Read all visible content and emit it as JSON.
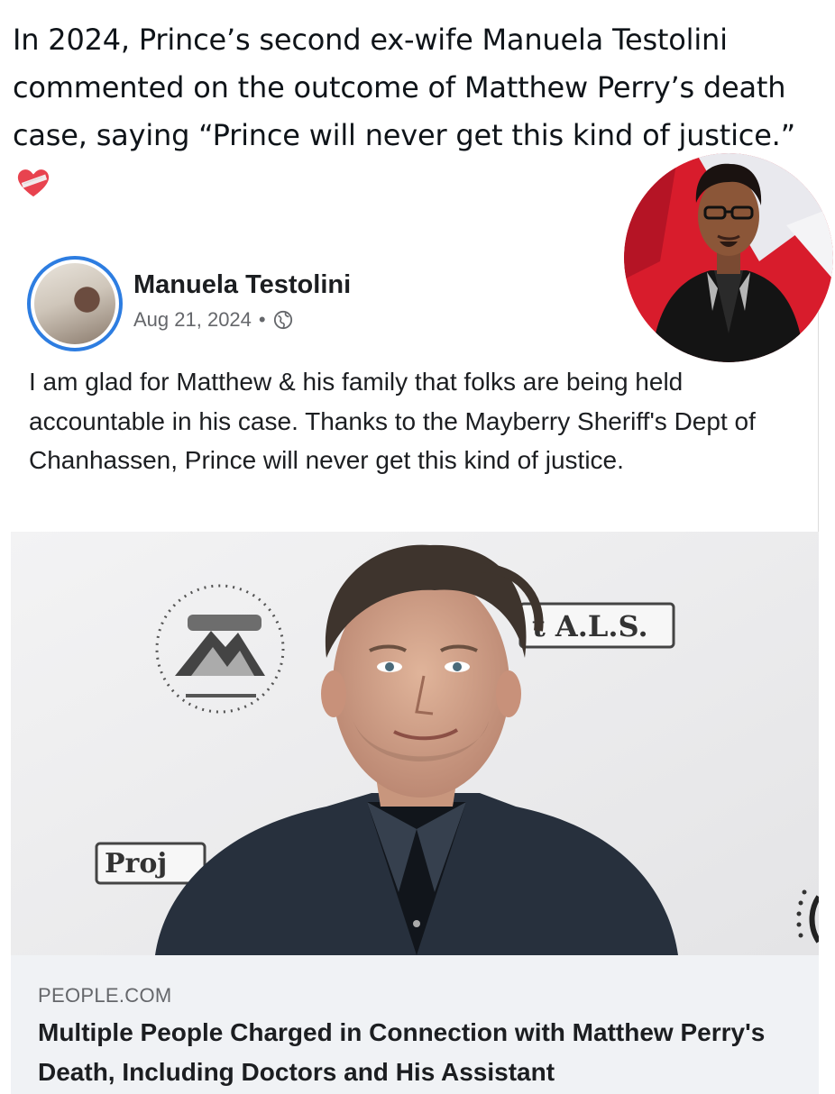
{
  "headline": {
    "text": "In 2024, Prince’s second ex-wife Manuela Testolini commented on the outcome of Matthew Perry’s death case, saying “Prince will never get this kind of justice.”",
    "emoji": "mending-heart-icon"
  },
  "post": {
    "author": "Manuela Testolini",
    "date": "Aug 21, 2024",
    "separator": "•",
    "audience_icon": "globe-icon",
    "body": "I am glad for Matthew & his family that folks are being held accountable in his case. Thanks to the Mayberry Sheriff's Dept of Chanhassen, Prince will never get this kind of justice."
  },
  "link_preview": {
    "backdrop_text_right": "t A.L.S.",
    "backdrop_text_left": "Proj",
    "domain": "PEOPLE.COM",
    "title": "Multiple People Charged in Connection with Matthew Perry's Death, Including Doctors and His Assistant"
  },
  "colors": {
    "avatar_ring": "#2d7de1",
    "link_footer_bg": "#f0f2f5",
    "meta_text": "#65676b"
  }
}
